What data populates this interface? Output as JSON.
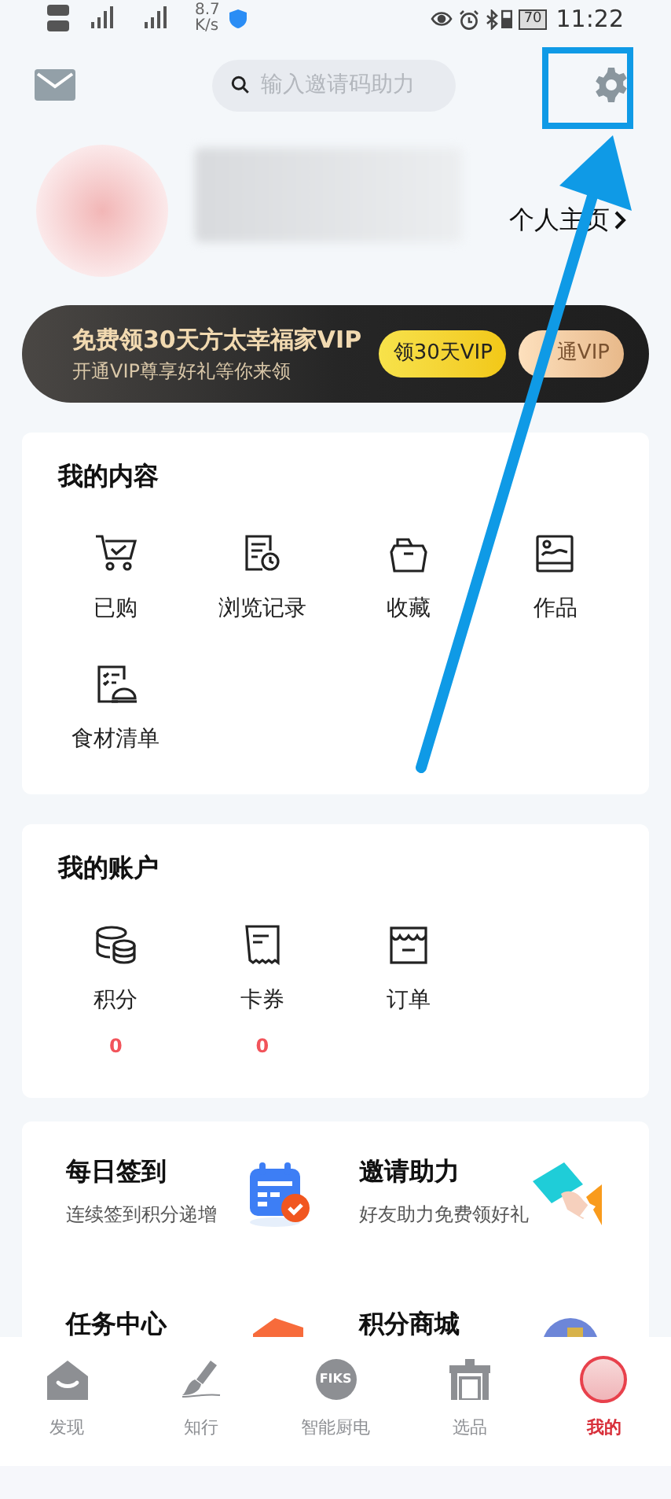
{
  "status_bar": {
    "speed": "8.7",
    "speed_unit": "K/s",
    "battery": "70",
    "time": "11:22"
  },
  "header": {
    "search": {
      "placeholder": "输入邀请码助力"
    }
  },
  "profile": {
    "homepage_link": "个人主页"
  },
  "vip_banner": {
    "title": "免费领30天方太幸福家VIP",
    "subtitle": "开通VIP尊享好礼等你来领",
    "buttons": [
      {
        "label": "领30天VIP",
        "kind": "primary"
      },
      {
        "label": "通VIP",
        "kind": "secondary"
      }
    ]
  },
  "my_content": {
    "title": "我的内容",
    "items": [
      {
        "label": "已购",
        "kind": "cart"
      },
      {
        "label": "浏览记录",
        "kind": "history"
      },
      {
        "label": "收藏",
        "kind": "folder"
      },
      {
        "label": "作品",
        "kind": "works"
      },
      {
        "label": "食材清单",
        "kind": "list"
      }
    ]
  },
  "my_account": {
    "title": "我的账户",
    "items": [
      {
        "label": "积分",
        "kind": "coins",
        "count": "0"
      },
      {
        "label": "卡券",
        "kind": "coupon",
        "count": "0"
      },
      {
        "label": "订单",
        "kind": "order"
      }
    ]
  },
  "promos": [
    {
      "title": "每日签到",
      "subtitle": "连续签到积分递增",
      "kind": "calendar"
    },
    {
      "title": "邀请助力",
      "subtitle": "好友助力免费领好礼",
      "kind": "ticket"
    },
    {
      "title": "任务中心",
      "kind": "task"
    },
    {
      "title": "积分商城",
      "kind": "mall"
    }
  ],
  "bottom_nav": [
    {
      "label": "发现",
      "kind": "home",
      "selected": false
    },
    {
      "label": "知行",
      "kind": "brush",
      "selected": false
    },
    {
      "label": "智能厨电",
      "kind": "logo",
      "logo_text": "FIKS",
      "selected": false
    },
    {
      "label": "选品",
      "kind": "shop",
      "selected": false
    },
    {
      "label": "我的",
      "kind": "avatar",
      "selected": true
    }
  ]
}
